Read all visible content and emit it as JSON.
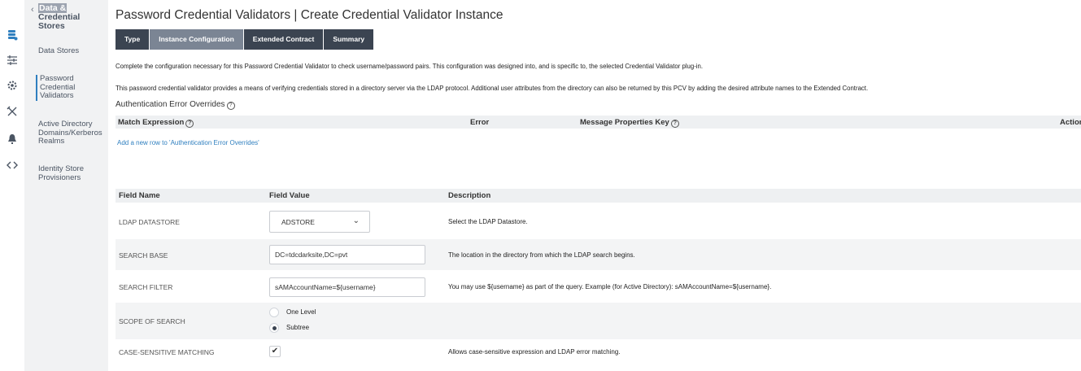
{
  "rail": {
    "icons": [
      "datastore-icon",
      "sliders-icon",
      "gear-icon",
      "crossed-tools-icon",
      "bell-icon",
      "code-icon"
    ]
  },
  "section_nav": {
    "back_title_highlight": "Data &",
    "back_title_rest": "Credential Stores",
    "items": [
      {
        "label": "Data Stores"
      },
      {
        "label": "Password Credential Validators"
      },
      {
        "label": "Active Directory Domains/Kerberos Realms"
      },
      {
        "label": "Identity Store Provisioners"
      }
    ]
  },
  "page": {
    "title": "Password Credential Validators | Create Credential Validator Instance",
    "tabs": [
      {
        "label": "Type"
      },
      {
        "label": "Instance Configuration"
      },
      {
        "label": "Extended Contract"
      },
      {
        "label": "Summary"
      }
    ],
    "intro1": "Complete the configuration necessary for this Password Credential Validator to check username/password pairs. This configuration was designed into, and is specific to, the selected Credential Validator plug-in.",
    "intro2": "This password credential validator provides a means of verifying credentials stored in a directory server via the LDAP protocol. Additional user attributes from the directory can also be returned by this PCV by adding the desired attribute names to the Extended Contract.",
    "overrides_heading": "Authentication Error Overrides"
  },
  "overrides_table": {
    "columns": {
      "match_expression": "Match Expression",
      "error": "Error",
      "message_key": "Message Properties Key",
      "action": "Action"
    },
    "add_link": "Add a new row to 'Authentication Error Overrides'"
  },
  "fields_table": {
    "columns": {
      "name": "Field Name",
      "value": "Field Value",
      "description": "Description"
    },
    "ldap_datastore": {
      "name": "LDAP DATASTORE",
      "value": "ADSTORE",
      "description": "Select the LDAP Datastore."
    },
    "search_base": {
      "name": "SEARCH BASE",
      "value": "DC=tdcdarksite,DC=pvt",
      "description": "The location in the directory from which the LDAP search begins."
    },
    "search_filter": {
      "name": "SEARCH FILTER",
      "value": "sAMAccountName=${username}",
      "description": "You may use ${username} as part of the query. Example (for Active Directory): sAMAccountName=${username}."
    },
    "scope_of_search": {
      "name": "SCOPE OF SEARCH",
      "options": [
        "One Level",
        "Subtree"
      ],
      "selected": "Subtree"
    },
    "case_sensitive": {
      "name": "CASE-SENSITIVE MATCHING",
      "checked": true,
      "description": "Allows case-sensitive expression and LDAP error matching."
    }
  },
  "colors": {
    "accent": "#2f7fbf",
    "tab_bg": "#3b4451",
    "tab_active_bg": "#7b8594",
    "nav_bg": "#f1f2f3"
  }
}
